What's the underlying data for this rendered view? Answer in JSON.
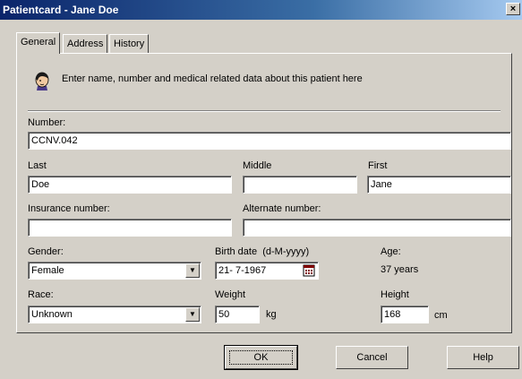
{
  "window": {
    "title": "Patientcard - Jane Doe",
    "close_label": "×"
  },
  "tabs": [
    {
      "label": "General",
      "active": true
    },
    {
      "label": "Address",
      "active": false
    },
    {
      "label": "History",
      "active": false
    }
  ],
  "intro": {
    "icon": "patient-head-icon",
    "text": "Enter name, number and medical related data about this patient here"
  },
  "form": {
    "number_label": "Number:",
    "number_value": "CCNV.042",
    "last_label": "Last",
    "last_value": "Doe",
    "middle_label": "Middle",
    "middle_value": "",
    "first_label": "First",
    "first_value": "Jane",
    "insurance_label": "Insurance number:",
    "insurance_value": "",
    "alternate_label": "Alternate number:",
    "alternate_value": "",
    "gender_label": "Gender:",
    "gender_value": "Female",
    "birth_label": "Birth date",
    "birth_format": "(d-M-yyyy)",
    "birth_value": "21- 7-1967",
    "age_label": "Age:",
    "age_value": "37 years",
    "race_label": "Race:",
    "race_value": "Unknown",
    "weight_label": "Weight",
    "weight_value": "50",
    "weight_unit": "kg",
    "height_label": "Height",
    "height_value": "168",
    "height_unit": "cm"
  },
  "buttons": {
    "ok": "OK",
    "cancel": "Cancel",
    "help": "Help"
  },
  "colors": {
    "titlebar": "#0a246a",
    "face": "#d4d0c8"
  }
}
